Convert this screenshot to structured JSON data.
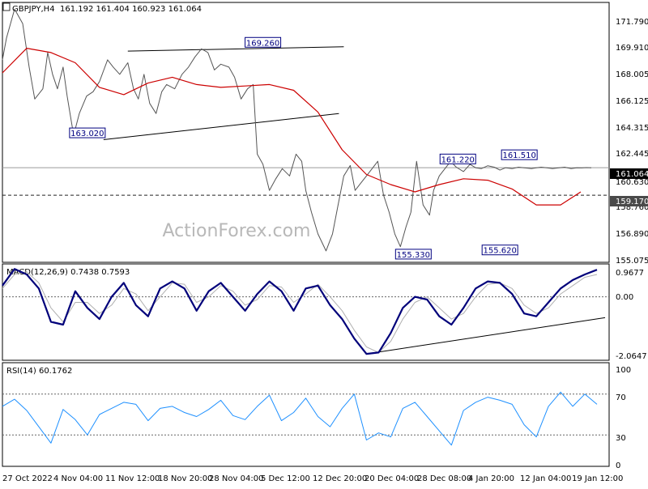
{
  "header": {
    "symbol_text": "GBPJPY,H4",
    "ohlc_text": "161.192 161.404 160.923 161.064"
  },
  "watermark": "ActionForex.com",
  "chart_data": [
    {
      "type": "line",
      "panel": "price",
      "ylim": [
        154.6,
        172.4
      ],
      "y_ticks": [
        "171.790",
        "169.910",
        "168.005",
        "166.125",
        "164.315",
        "162.445",
        "160.630",
        "158.760",
        "156.890",
        "155.075"
      ],
      "x_ticks": [
        "27 Oct 2022",
        "4 Nov 04:00",
        "11 Nov 12:00",
        "18 Nov 20:00",
        "28 Nov 04:00",
        "5 Dec 12:00",
        "12 Dec 20:00",
        "20 Dec 04:00",
        "28 Dec 08:00",
        "4 Jan 20:00",
        "12 Jan 04:00",
        "19 Jan 12:00"
      ],
      "current_price": {
        "label": "161.064",
        "value": 161.064
      },
      "support_line": {
        "label": "159.170",
        "value": 159.17
      },
      "price_series": {
        "x": [
          0.0,
          0.5,
          1.5,
          2.5,
          3.3,
          4.0,
          5.0,
          5.6,
          6.2,
          6.8,
          7.5,
          8.0,
          8.8,
          9.5,
          10.4,
          11.2,
          12.0,
          13.0,
          13.7,
          14.5,
          15.5,
          16.2,
          16.8,
          17.5,
          18.2,
          19.0,
          19.7,
          20.3,
          21.3,
          22.2,
          23.0,
          23.8,
          24.6,
          25.4,
          26.2,
          27.0,
          28.0,
          28.7,
          29.5,
          30.3,
          31.0,
          31.5,
          32.2,
          33.0,
          33.8,
          34.6,
          35.5,
          36.3,
          37.0,
          37.5,
          38.2,
          39.0,
          40.0,
          40.8,
          41.5,
          42.2,
          43.0,
          43.6,
          44.3,
          45.0,
          45.7,
          46.4,
          47.1,
          47.8,
          48.5,
          49.2,
          49.9,
          50.5,
          51.2,
          52.0,
          52.8,
          53.3,
          54.0,
          54.7,
          55.4,
          56.1,
          57.0,
          57.8,
          58.5,
          59.2,
          60.0,
          60.8,
          61.5,
          62.2,
          63.0,
          63.8,
          64.6,
          65.4,
          66.0,
          66.6,
          67.3,
          68.0,
          68.8,
          69.5,
          70.3,
          71.0,
          71.6,
          72.2,
          72.8
        ],
        "values": [
          168.5,
          170.0,
          172.0,
          171.0,
          168.0,
          165.8,
          166.5,
          169.0,
          167.5,
          166.5,
          168.0,
          166.0,
          163.3,
          164.8,
          166.0,
          166.3,
          167.0,
          168.5,
          168.0,
          167.5,
          168.3,
          166.5,
          165.8,
          167.5,
          165.5,
          164.8,
          166.3,
          166.8,
          166.5,
          167.5,
          168.0,
          168.7,
          169.26,
          169.0,
          167.8,
          168.2,
          168.0,
          167.3,
          165.8,
          166.5,
          166.8,
          162.0,
          161.3,
          159.5,
          160.3,
          161.0,
          160.5,
          162.0,
          161.5,
          159.5,
          158.0,
          156.5,
          155.33,
          156.5,
          158.5,
          160.5,
          161.22,
          159.5,
          160.0,
          160.5,
          161.0,
          161.51,
          159.2,
          158.0,
          156.5,
          155.62,
          157.0,
          158.0,
          161.51,
          158.5,
          157.8,
          159.5,
          160.5,
          161.0,
          161.5,
          161.1,
          160.8,
          161.3,
          161.064,
          161.0,
          161.2,
          161.1,
          160.9,
          161.064,
          161.0,
          161.1,
          161.05,
          161.0,
          161.064,
          161.1,
          161.064,
          161.0,
          161.064,
          161.1,
          161.0,
          161.064,
          161.05,
          161.07,
          161.064
        ]
      },
      "ma_series": {
        "x": [
          0,
          3,
          6,
          9,
          12,
          15,
          18,
          21,
          24,
          27,
          30,
          33,
          36,
          39,
          42,
          45,
          48,
          51,
          54,
          57,
          60,
          63,
          66,
          69,
          71.5
        ],
        "values": [
          167.6,
          169.3,
          169.0,
          168.3,
          166.6,
          166.1,
          166.9,
          167.3,
          166.8,
          166.6,
          166.7,
          166.8,
          166.4,
          164.9,
          162.3,
          160.6,
          159.9,
          159.4,
          159.9,
          160.3,
          160.2,
          159.6,
          158.5,
          158.5,
          159.4
        ]
      },
      "annotations": [
        {
          "label": "169.260",
          "x": 32.2,
          "y": 169.26
        },
        {
          "label": "163.020",
          "x": 10.5,
          "y": 163.02
        },
        {
          "label": "155.330",
          "x": 50.8,
          "y": 155.33
        },
        {
          "label": "161.220",
          "x": 56.3,
          "y": 161.22
        },
        {
          "label": "161.510",
          "x": 63.9,
          "y": 161.51
        },
        {
          "label": "155.620",
          "x": 61.5,
          "y": 155.62
        }
      ],
      "trendlines": [
        {
          "x": [
            15.5,
            42.2
          ],
          "values": [
            169.1,
            169.4
          ]
        },
        {
          "x": [
            12.5,
            41.6
          ],
          "values": [
            163.0,
            164.8
          ]
        }
      ]
    },
    {
      "type": "line",
      "panel": "macd",
      "title": "MACD(12,26,9) 0.7438 0.7593",
      "ylim": [
        -2.25,
        1.15
      ],
      "y_ticks": [
        "0.9677",
        "0.00",
        "-2.0647"
      ],
      "macd_series": {
        "x": [
          0,
          1.5,
          3,
          4.5,
          6,
          7.5,
          9,
          10.5,
          12,
          13.5,
          15,
          16.5,
          18,
          19.5,
          21,
          22.5,
          24,
          25.5,
          27,
          28.5,
          30,
          31.5,
          33,
          34.5,
          36,
          37.5,
          39,
          40.5,
          42,
          43.5,
          45,
          46.5,
          48,
          49.5,
          51,
          52.5,
          54,
          55.5,
          57,
          58.5,
          60,
          61.5,
          63,
          64.5,
          66,
          67.5,
          69,
          70.5,
          72,
          73.5
        ],
        "values": [
          0.4,
          1.0,
          0.8,
          0.3,
          -0.9,
          -1.0,
          0.2,
          -0.4,
          -0.8,
          0.0,
          0.5,
          -0.3,
          -0.7,
          0.3,
          0.55,
          0.3,
          -0.5,
          0.2,
          0.5,
          0.0,
          -0.5,
          0.1,
          0.55,
          0.2,
          -0.5,
          0.3,
          0.4,
          -0.3,
          -0.8,
          -1.5,
          -2.05,
          -2.0,
          -1.3,
          -0.4,
          0.0,
          -0.1,
          -0.7,
          -1.0,
          -0.4,
          0.3,
          0.55,
          0.5,
          0.1,
          -0.6,
          -0.7,
          -0.2,
          0.3,
          0.6,
          0.8,
          0.97
        ]
      },
      "signal_series": {
        "x": [
          0,
          1.5,
          3,
          4.5,
          6,
          7.5,
          9,
          10.5,
          12,
          13.5,
          15,
          16.5,
          18,
          19.5,
          21,
          22.5,
          24,
          25.5,
          27,
          28.5,
          30,
          31.5,
          33,
          34.5,
          36,
          37.5,
          39,
          40.5,
          42,
          43.5,
          45,
          46.5,
          48,
          49.5,
          51,
          52.5,
          54,
          55.5,
          57,
          58.5,
          60,
          61.5,
          63,
          64.5,
          66,
          67.5,
          69,
          70.5,
          72,
          73.5
        ],
        "values": [
          0.3,
          0.8,
          0.9,
          0.5,
          -0.4,
          -0.9,
          -0.2,
          -0.2,
          -0.6,
          -0.3,
          0.3,
          0.1,
          -0.5,
          0.0,
          0.5,
          0.45,
          -0.2,
          0.0,
          0.4,
          0.2,
          -0.3,
          -0.1,
          0.4,
          0.35,
          -0.2,
          0.1,
          0.45,
          0.0,
          -0.5,
          -1.2,
          -1.8,
          -2.0,
          -1.6,
          -0.8,
          -0.2,
          0.0,
          -0.4,
          -0.8,
          -0.6,
          0.0,
          0.45,
          0.5,
          0.3,
          -0.3,
          -0.6,
          -0.4,
          0.1,
          0.4,
          0.7,
          0.8
        ]
      },
      "trendlines": [
        {
          "x": [
            45.0,
            74.5
          ],
          "values": [
            -2.05,
            -0.75
          ]
        }
      ]
    },
    {
      "type": "line",
      "panel": "rsi",
      "title": "RSI(14) 60.1762",
      "ylim": [
        0,
        100
      ],
      "y_ticks": [
        "100",
        "70",
        "30",
        "0"
      ],
      "rsi_series": {
        "x": [
          0,
          1.5,
          3,
          4.5,
          6,
          7.5,
          9,
          10.5,
          12,
          13.5,
          15,
          16.5,
          18,
          19.5,
          21,
          22.5,
          24,
          25.5,
          27,
          28.5,
          30,
          31.5,
          33,
          34.5,
          36,
          37.5,
          39,
          40.5,
          42,
          43.5,
          45,
          46.5,
          48,
          49.5,
          51,
          52.5,
          54,
          55.5,
          57,
          58.5,
          60,
          61.5,
          63,
          64.5,
          66,
          67.5,
          69,
          70.5,
          72,
          73.5
        ],
        "values": [
          58,
          65,
          54,
          38,
          22,
          55,
          45,
          30,
          50,
          56,
          62,
          60,
          44,
          56,
          58,
          52,
          48,
          55,
          64,
          49,
          45,
          58,
          69,
          44,
          52,
          66,
          48,
          38,
          56,
          70,
          25,
          32,
          28,
          56,
          62,
          48,
          34,
          20,
          54,
          62,
          67,
          64,
          60,
          40,
          28,
          58,
          72,
          58,
          70,
          60
        ]
      }
    }
  ]
}
